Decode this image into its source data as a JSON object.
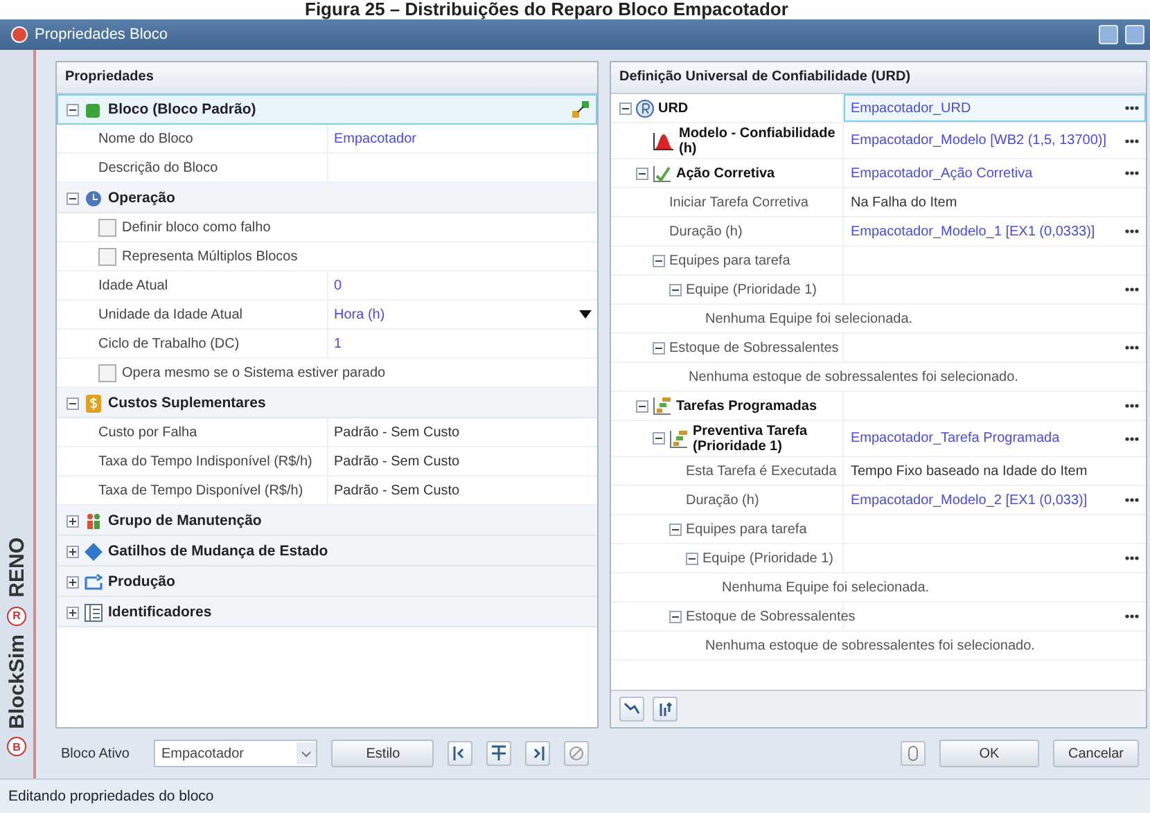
{
  "caption": "Figura 25 – Distribuições do Reparo Bloco Empacotador",
  "window": {
    "title": "Propriedades Bloco"
  },
  "side_brand": [
    {
      "text": "RENO",
      "badge": "R"
    },
    {
      "text": "BlockSim",
      "badge": "B"
    }
  ],
  "properties": {
    "title": "Propriedades",
    "categories": [
      {
        "label": "Bloco (Bloco Padrão)",
        "kind": "block",
        "expanded": true,
        "selected": true,
        "rows": [
          {
            "kind": "text",
            "label": "Nome do Bloco",
            "value": "Empacotador",
            "linked": true
          },
          {
            "kind": "text",
            "label": "Descrição do Bloco"
          }
        ]
      },
      {
        "label": "Operação",
        "kind": "operation",
        "expanded": true,
        "selected": false,
        "rows": [
          {
            "kind": "checkbox",
            "label": "Definir bloco como falho",
            "checked": false
          },
          {
            "kind": "checkbox",
            "label": "Representa Múltiplos Blocos",
            "checked": false
          },
          {
            "kind": "text",
            "label": "Idade Atual",
            "value": "0",
            "linked": true
          },
          {
            "kind": "dropdown",
            "label": "Unidade da Idade Atual",
            "value": "Hora (h)",
            "linked": true
          },
          {
            "kind": "text",
            "label": "Ciclo de Trabalho (DC)",
            "value": "1",
            "linked": true
          },
          {
            "kind": "checkbox",
            "label": "Opera mesmo se o Sistema estiver parado",
            "checked": false
          }
        ]
      },
      {
        "label": "Custos Suplementares",
        "kind": "cost",
        "expanded": true,
        "selected": false,
        "rows": [
          {
            "kind": "text",
            "label": "Custo por Falha",
            "value": "Padrão - Sem Custo",
            "linked": false
          },
          {
            "kind": "text",
            "label": "Taxa do Tempo Indisponível (R$/h)",
            "value": "Padrão - Sem Custo",
            "linked": false
          },
          {
            "kind": "text",
            "label": "Taxa de Tempo Disponível (R$/h)",
            "value": "Padrão - Sem Custo",
            "linked": false
          }
        ]
      },
      {
        "label": "Grupo de Manutenção",
        "kind": "maintenance",
        "expanded": false,
        "selected": false
      },
      {
        "label": "Gatilhos de Mudança de Estado",
        "kind": "trigger",
        "expanded": false,
        "selected": false
      },
      {
        "label": "Produção",
        "kind": "production",
        "expanded": false,
        "selected": false
      },
      {
        "label": "Identificadores",
        "kind": "identifier",
        "expanded": false,
        "selected": false
      }
    ]
  },
  "urd": {
    "title": "Definição Universal de Confiabilidade (URD)",
    "tree": [
      {
        "kind": "urd",
        "label": "URD",
        "bold": true,
        "expanded": true,
        "value": "Empacotador_URD",
        "linked": true,
        "more": true,
        "selected": true,
        "children": [
          {
            "kind": "model",
            "label": "Modelo - Confiabilidade (h)",
            "bold": true,
            "value": "Empacotador_Modelo [WB2 (1,5, 13700)]",
            "linked": true,
            "more": true,
            "selected": false
          },
          {
            "kind": "corrective",
            "label": "Ação Corretiva",
            "bold": true,
            "expanded": true,
            "value": "Empacotador_Ação Corretiva",
            "linked": true,
            "more": true,
            "selected": false,
            "children": [
              {
                "kind": "property",
                "label": "Iniciar Tarefa Corretiva",
                "value": "Na Falha do Item",
                "linked": false,
                "more": false,
                "selected": false
              },
              {
                "kind": "property",
                "label": "Duração (h)",
                "value": "Empacotador_Modelo_1 [EX1 (0,0333)]",
                "linked": true,
                "more": true,
                "selected": false
              },
              {
                "kind": "property",
                "label": "Equipes para tarefa",
                "expanded": true,
                "more": false,
                "selected": false,
                "children": [
                  {
                    "kind": "property",
                    "label": "Equipe (Prioridade 1)",
                    "expanded": true,
                    "more": true,
                    "selected": false,
                    "children": [
                      {
                        "kind": "note",
                        "label": "Nenhuma Equipe foi selecionada."
                      }
                    ]
                  }
                ]
              },
              {
                "kind": "property",
                "label": "Estoque de Sobressalentes",
                "expanded": true,
                "more": true,
                "selected": false,
                "children": [
                  {
                    "kind": "note",
                    "label": "Nenhuma estoque de sobressalentes foi selecionado."
                  }
                ]
              }
            ]
          },
          {
            "kind": "scheduled",
            "label": "Tarefas Programadas",
            "bold": true,
            "expanded": true,
            "more": true,
            "selected": false,
            "children": [
              {
                "kind": "scheduled",
                "label": "Preventiva Tarefa (Prioridade 1)",
                "bold": true,
                "expanded": true,
                "value": "Empacotador_Tarefa Programada",
                "linked": true,
                "more": true,
                "selected": false,
                "children": [
                  {
                    "kind": "property",
                    "label": "Esta Tarefa é Executada",
                    "value": "Tempo Fixo baseado na Idade do Item",
                    "linked": false,
                    "more": false,
                    "selected": false
                  },
                  {
                    "kind": "property",
                    "label": "Duração (h)",
                    "value": "Empacotador_Modelo_2 [EX1 (0,033)]",
                    "linked": true,
                    "more": true,
                    "selected": false
                  },
                  {
                    "kind": "property",
                    "label": "Equipes para tarefa",
                    "expanded": true,
                    "more": false,
                    "selected": false,
                    "children": [
                      {
                        "kind": "property",
                        "label": "Equipe (Prioridade 1)",
                        "expanded": true,
                        "more": true,
                        "selected": false,
                        "children": [
                          {
                            "kind": "note",
                            "label": "Nenhuma Equipe foi selecionada."
                          }
                        ]
                      }
                    ]
                  },
                  {
                    "kind": "property",
                    "label": "Estoque de Sobressalentes",
                    "expanded": true,
                    "more": true,
                    "selected": false,
                    "children": [
                      {
                        "kind": "note",
                        "label": "Nenhuma estoque de sobressalentes foi selecionado."
                      }
                    ]
                  }
                ]
              }
            ]
          }
        ]
      }
    ]
  },
  "bottom": {
    "active_label": "Bloco Ativo",
    "active_value": "Empacotador",
    "style_button": "Estilo",
    "ok": "OK",
    "cancel": "Cancelar"
  },
  "status_bar": "Editando propriedades do bloco"
}
